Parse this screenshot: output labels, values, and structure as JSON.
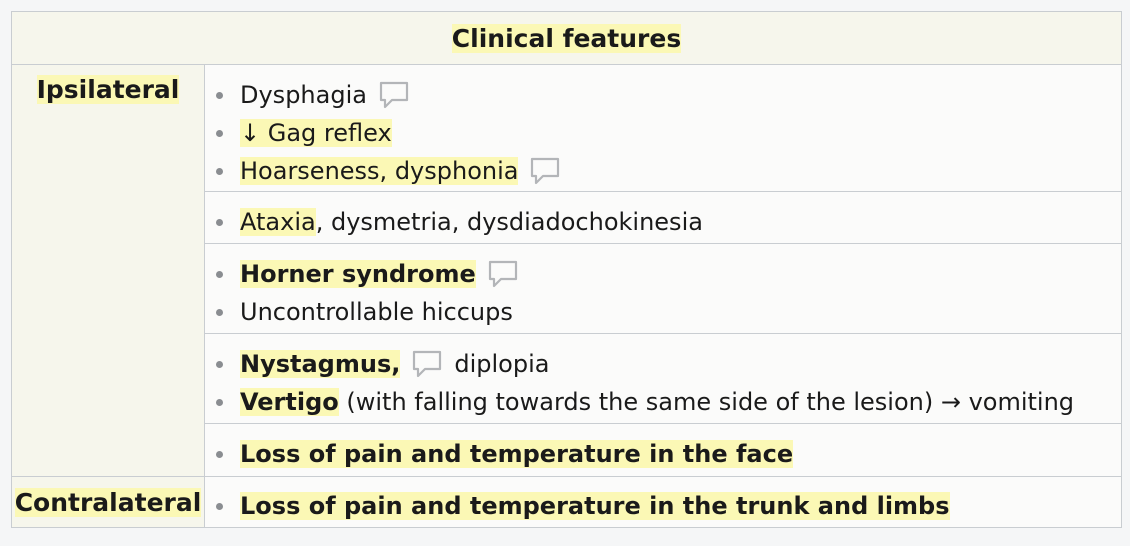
{
  "table": {
    "header": "Clinical features",
    "ipsilateral": {
      "label": "Ipsilateral",
      "groups": [
        {
          "items": [
            {
              "text": "Dysphagia"
            },
            {
              "text": "↓ Gag reflex"
            },
            {
              "text": "Hoarseness, dysphonia"
            }
          ]
        },
        {
          "items": [
            {
              "highlight": "Ataxia",
              "rest": ", dysmetria, dysdiadochokinesia"
            }
          ]
        },
        {
          "items": [
            {
              "text": "Horner syndrome"
            },
            {
              "text": "Uncontrollable hiccups"
            }
          ]
        },
        {
          "items": [
            {
              "bold": "Nystagmus,",
              "rest": "diplopia"
            },
            {
              "bold": "Vertigo",
              "rest": " (with falling towards the same side of the lesion) → vomiting"
            }
          ]
        },
        {
          "items": [
            {
              "text": "Loss of pain and temperature in the face"
            }
          ]
        }
      ]
    },
    "contralateral": {
      "label": "Contralateral",
      "items": [
        {
          "text": "Loss of pain and temperature in the trunk and limbs"
        }
      ]
    }
  },
  "icons": {
    "comment": "comment-icon",
    "bullet": "bullet-dot"
  },
  "colors": {
    "highlight": "#fbf8b5",
    "header_bg": "#f6f6ec",
    "border": "#c9cdd1"
  }
}
